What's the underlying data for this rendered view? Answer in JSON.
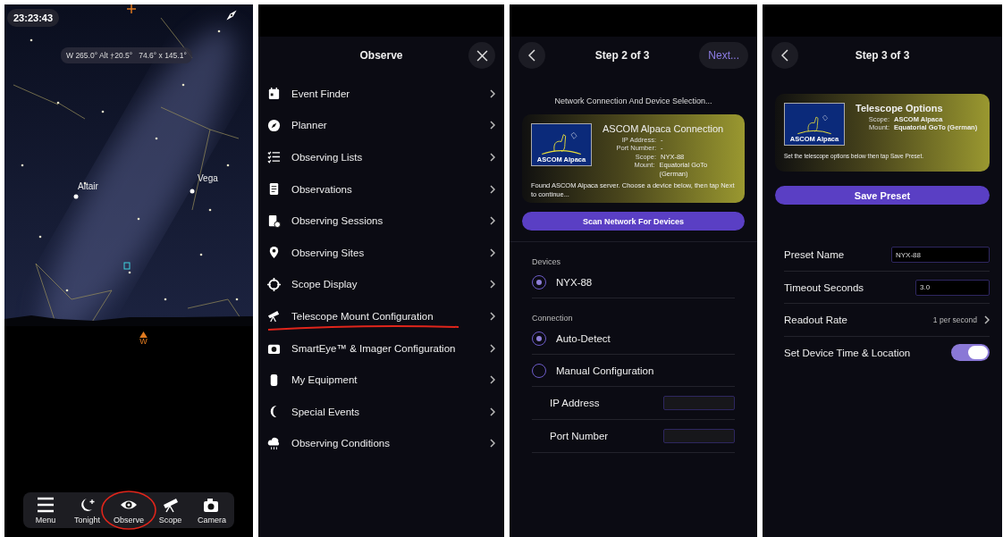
{
  "sky_view": {
    "time": "23:23:43",
    "pointing": "W 265.0° Alt +20.5°   74.6° x 145.1°",
    "star_labels": [
      "Altair",
      "Vega"
    ],
    "compass_mark": "W",
    "tabs": [
      {
        "label": "Menu",
        "circled": false
      },
      {
        "label": "Tonight",
        "circled": false
      },
      {
        "label": "Observe",
        "circled": true
      },
      {
        "label": "Scope",
        "circled": false
      },
      {
        "label": "Camera",
        "circled": false
      }
    ]
  },
  "observe_menu": {
    "title": "Observe",
    "items": [
      {
        "label": "Event Finder",
        "underlined": false
      },
      {
        "label": "Planner",
        "underlined": false
      },
      {
        "label": "Observing Lists",
        "underlined": false
      },
      {
        "label": "Observations",
        "underlined": false
      },
      {
        "label": "Observing Sessions",
        "underlined": false
      },
      {
        "label": "Observing Sites",
        "underlined": false
      },
      {
        "label": "Scope Display",
        "underlined": false
      },
      {
        "label": "Telescope Mount Configuration",
        "underlined": true
      },
      {
        "label": "SmartEye™ & Imager Configuration",
        "underlined": false
      },
      {
        "label": "My Equipment",
        "underlined": false
      },
      {
        "label": "Special Events",
        "underlined": false
      },
      {
        "label": "Observing Conditions",
        "underlined": false
      }
    ]
  },
  "step_2": {
    "title": "Step 2 of 3",
    "next_button": "Next...",
    "subtitle": "Network Connection And Device Selection...",
    "card": {
      "logo_text": "ASCOM Alpaca",
      "title": "ASCOM Alpaca Connection",
      "fields": [
        {
          "label": "IP Address:",
          "value": "-"
        },
        {
          "label": "Port Number:",
          "value": "-"
        },
        {
          "label": "Scope:",
          "value": "NYX-88"
        },
        {
          "label": "Mount:",
          "value": "Equatorial GoTo (German)"
        }
      ],
      "message": "Found ASCOM Alpaca server. Choose a device below, then tap Next to continue..."
    },
    "scan_button": "Scan Network For Devices",
    "devices_header": "Devices",
    "devices": [
      {
        "label": "NYX-88",
        "selected": true
      }
    ],
    "connection_header": "Connection",
    "connections": [
      {
        "label": "Auto-Detect",
        "selected": true
      },
      {
        "label": "Manual Configuration",
        "selected": false
      }
    ],
    "manual_fields": [
      {
        "label": "IP Address"
      },
      {
        "label": "Port Number"
      }
    ]
  },
  "step_3": {
    "title": "Step 3 of 3",
    "card": {
      "logo_text": "ASCOM Alpaca",
      "title": "Telescope Options",
      "fields": [
        {
          "label": "Scope:",
          "value": "ASCOM Alpaca"
        },
        {
          "label": "Mount:",
          "value": "Equatorial GoTo (German)"
        }
      ],
      "message": "Set the telescope options below then tap Save Preset."
    },
    "save_button": "Save Preset",
    "settings": [
      {
        "kind": "field",
        "label": "Preset Name",
        "value": "NYX-88"
      },
      {
        "kind": "field",
        "label": "Timeout Seconds",
        "value": "3.0"
      },
      {
        "kind": "choice",
        "label": "Readout Rate",
        "value": "1 per second"
      },
      {
        "kind": "toggle",
        "label": "Set Device Time & Location",
        "on": true
      }
    ]
  }
}
